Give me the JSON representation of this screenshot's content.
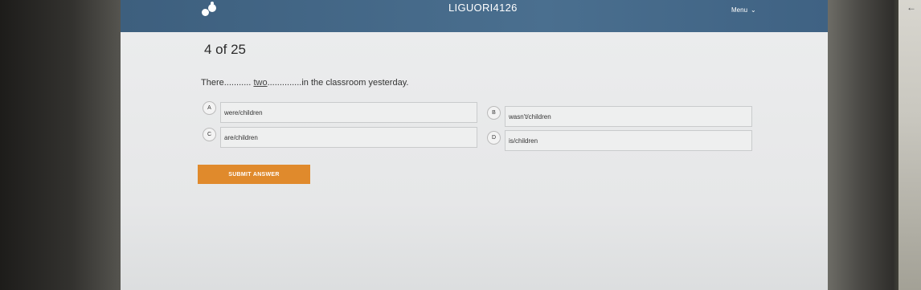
{
  "header": {
    "title": "LIGUORI4126",
    "menu_label": "Menu",
    "menu_icon": "chevron-down-icon"
  },
  "quiz": {
    "progress": "4 of 25",
    "question": {
      "prefix": "There",
      "blank1": "...........",
      "answer_filled": "two",
      "blank2": "..............",
      "suffix": "in the classroom yesterday."
    },
    "options": [
      {
        "letter": "A",
        "text": "were/children"
      },
      {
        "letter": "B",
        "text": "wasn't/children"
      },
      {
        "letter": "C",
        "text": "are/children"
      },
      {
        "letter": "D",
        "text": "is/children"
      }
    ],
    "submit_label": "SUBMIT ANSWER"
  },
  "colors": {
    "header_bg": "#4a6f8f",
    "submit_bg": "#e08a2c",
    "page_bg": "#ecedee"
  }
}
